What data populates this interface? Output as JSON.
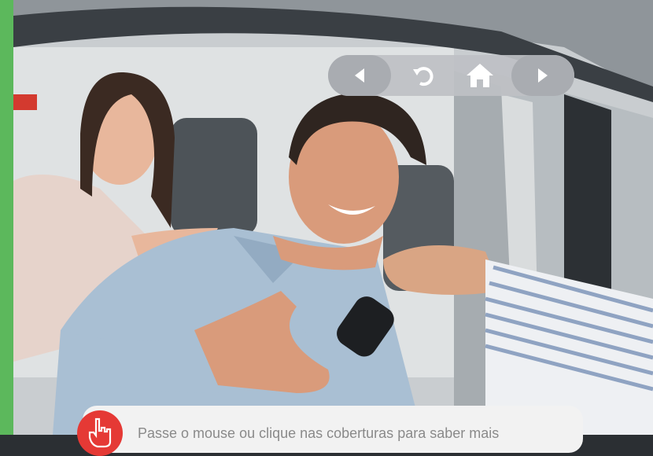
{
  "navigation": {
    "prev_icon": "arrow-left-icon",
    "undo_icon": "undo-icon",
    "home_icon": "home-icon",
    "next_icon": "arrow-right-icon"
  },
  "hint": {
    "text": "Passe o mouse ou clique nas coberturas para saber mais",
    "icon": "pointing-hand-icon"
  },
  "colors": {
    "accent_green": "#5cb85c",
    "badge_red": "#e53935",
    "nav_bg": "#bec0c4"
  }
}
